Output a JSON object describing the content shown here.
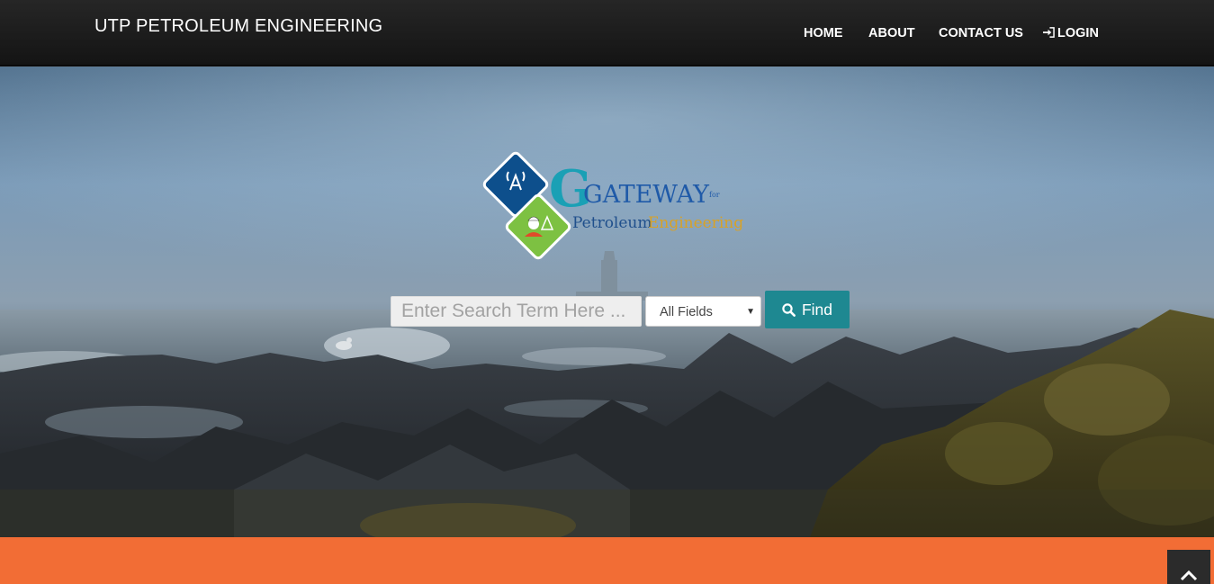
{
  "navbar": {
    "brand": "UTP PETROLEUM ENGINEERING",
    "items": [
      {
        "label": "HOME"
      },
      {
        "label": "ABOUT"
      },
      {
        "label": "CONTACT US"
      },
      {
        "label": "LOGIN",
        "icon": "sign-in-icon"
      }
    ]
  },
  "logo": {
    "main": "GATEWAY",
    "for": "for",
    "sub1": "Petroleum",
    "sub2": "Engineering"
  },
  "search": {
    "placeholder": "Enter Search Term Here ...",
    "value": "",
    "field_selected": "All Fields",
    "button_label": "Find",
    "button_icon": "search-icon"
  },
  "colors": {
    "nav_bg": "#1a1a1a",
    "find_button": "#1e8891",
    "footer_band": "#f26d35",
    "logo_blue": "#0d4f8c",
    "logo_green": "#7dc142"
  },
  "scroll_top_icon": "chevron-up-icon"
}
